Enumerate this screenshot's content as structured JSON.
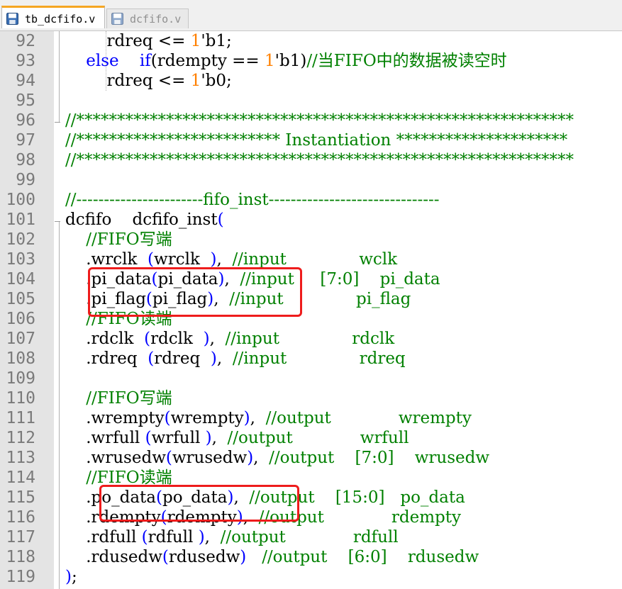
{
  "tabs": [
    {
      "label": "tb_dcfifo.v",
      "active": true,
      "icon": "save-disk-icon"
    },
    {
      "label": "dcfifo.v",
      "active": false,
      "icon": "save-disk-icon"
    }
  ],
  "colors": {
    "keyword": "#0000ff",
    "comment": "#008000",
    "number": "#ff8000",
    "highlight_box": "#ee1c1c",
    "active_tab_accent": "#f5a623"
  },
  "lines": [
    {
      "n": "92",
      "segs": [
        {
          "t": "        rdreq <= ",
          "c": ""
        },
        {
          "t": "1",
          "c": "num"
        },
        {
          "t": "'b1;",
          "c": ""
        }
      ]
    },
    {
      "n": "93",
      "segs": [
        {
          "t": "    ",
          "c": ""
        },
        {
          "t": "else",
          "c": "kw"
        },
        {
          "t": "    ",
          "c": ""
        },
        {
          "t": "if",
          "c": "kw"
        },
        {
          "t": "(rdempty == ",
          "c": ""
        },
        {
          "t": "1",
          "c": "num"
        },
        {
          "t": "'b1)",
          "c": ""
        },
        {
          "t": "//当FIFO中的数据被读空时",
          "c": "cm"
        }
      ]
    },
    {
      "n": "94",
      "segs": [
        {
          "t": "        rdreq <= ",
          "c": ""
        },
        {
          "t": "1",
          "c": "num"
        },
        {
          "t": "'b0;",
          "c": ""
        }
      ]
    },
    {
      "n": "95",
      "segs": []
    },
    {
      "n": "96",
      "segs": [
        {
          "t": "//*************************************************************",
          "c": "cm"
        }
      ]
    },
    {
      "n": "97",
      "segs": [
        {
          "t": "//************************* Instantiation *********************",
          "c": "cm"
        }
      ]
    },
    {
      "n": "98",
      "segs": [
        {
          "t": "//*************************************************************",
          "c": "cm"
        }
      ]
    },
    {
      "n": "99",
      "segs": []
    },
    {
      "n": "100",
      "segs": [
        {
          "t": "//-----------------------fifo_inst-------------------------------",
          "c": "cm"
        }
      ]
    },
    {
      "n": "101",
      "segs": [
        {
          "t": "dcfifo    dcfifo_inst",
          "c": ""
        },
        {
          "t": "(",
          "c": "br"
        }
      ]
    },
    {
      "n": "102",
      "segs": [
        {
          "t": "    ",
          "c": ""
        },
        {
          "t": "//FIFO写端",
          "c": "cm"
        }
      ]
    },
    {
      "n": "103",
      "segs": [
        {
          "t": "    .wrclk  ",
          "c": ""
        },
        {
          "t": "(",
          "c": "br"
        },
        {
          "t": "wrclk  ",
          "c": ""
        },
        {
          "t": ")",
          "c": "br"
        },
        {
          "t": ",  ",
          "c": ""
        },
        {
          "t": "//input              wclk",
          "c": "cm"
        }
      ]
    },
    {
      "n": "104",
      "segs": [
        {
          "t": "    .pi_data",
          "c": ""
        },
        {
          "t": "(",
          "c": "br"
        },
        {
          "t": "pi_data",
          "c": ""
        },
        {
          "t": ")",
          "c": "br"
        },
        {
          "t": ",  ",
          "c": ""
        },
        {
          "t": "//input     [7:0]    pi_data",
          "c": "cm"
        }
      ]
    },
    {
      "n": "105",
      "segs": [
        {
          "t": "    .pi_flag",
          "c": ""
        },
        {
          "t": "(",
          "c": "br"
        },
        {
          "t": "pi_flag",
          "c": ""
        },
        {
          "t": ")",
          "c": "br"
        },
        {
          "t": ",  ",
          "c": ""
        },
        {
          "t": "//input              pi_flag",
          "c": "cm"
        }
      ]
    },
    {
      "n": "106",
      "segs": [
        {
          "t": "    ",
          "c": ""
        },
        {
          "t": "//FIFO读端",
          "c": "cm"
        }
      ]
    },
    {
      "n": "107",
      "segs": [
        {
          "t": "    .rdclk  ",
          "c": ""
        },
        {
          "t": "(",
          "c": "br"
        },
        {
          "t": "rdclk  ",
          "c": ""
        },
        {
          "t": ")",
          "c": "br"
        },
        {
          "t": ",  ",
          "c": ""
        },
        {
          "t": "//input              rdclk",
          "c": "cm"
        }
      ]
    },
    {
      "n": "108",
      "segs": [
        {
          "t": "    .rdreq  ",
          "c": ""
        },
        {
          "t": "(",
          "c": "br"
        },
        {
          "t": "rdreq  ",
          "c": ""
        },
        {
          "t": ")",
          "c": "br"
        },
        {
          "t": ",  ",
          "c": ""
        },
        {
          "t": "//input              rdreq",
          "c": "cm"
        }
      ]
    },
    {
      "n": "109",
      "segs": []
    },
    {
      "n": "110",
      "segs": [
        {
          "t": "    ",
          "c": ""
        },
        {
          "t": "//FIFO写端",
          "c": "cm"
        }
      ]
    },
    {
      "n": "111",
      "segs": [
        {
          "t": "    .wrempty",
          "c": ""
        },
        {
          "t": "(",
          "c": "br"
        },
        {
          "t": "wrempty",
          "c": ""
        },
        {
          "t": ")",
          "c": "br"
        },
        {
          "t": ",  ",
          "c": ""
        },
        {
          "t": "//output             wrempty",
          "c": "cm"
        }
      ]
    },
    {
      "n": "112",
      "segs": [
        {
          "t": "    .wrfull ",
          "c": ""
        },
        {
          "t": "(",
          "c": "br"
        },
        {
          "t": "wrfull ",
          "c": ""
        },
        {
          "t": ")",
          "c": "br"
        },
        {
          "t": ",  ",
          "c": ""
        },
        {
          "t": "//output             wrfull",
          "c": "cm"
        }
      ]
    },
    {
      "n": "113",
      "segs": [
        {
          "t": "    .wrusedw",
          "c": ""
        },
        {
          "t": "(",
          "c": "br"
        },
        {
          "t": "wrusedw",
          "c": ""
        },
        {
          "t": ")",
          "c": "br"
        },
        {
          "t": ",  ",
          "c": ""
        },
        {
          "t": "//output    [7:0]    wrusedw",
          "c": "cm"
        }
      ]
    },
    {
      "n": "114",
      "segs": [
        {
          "t": "    ",
          "c": ""
        },
        {
          "t": "//FIFO读端",
          "c": "cm"
        }
      ]
    },
    {
      "n": "115",
      "segs": [
        {
          "t": "    .po_data",
          "c": ""
        },
        {
          "t": "(",
          "c": "br"
        },
        {
          "t": "po_data",
          "c": ""
        },
        {
          "t": ")",
          "c": "br"
        },
        {
          "t": ",  ",
          "c": ""
        },
        {
          "t": "//output    [15:0]   po_data",
          "c": "cm"
        }
      ]
    },
    {
      "n": "116",
      "segs": [
        {
          "t": "    .rdempty",
          "c": ""
        },
        {
          "t": "(",
          "c": "br"
        },
        {
          "t": "rdempty",
          "c": ""
        },
        {
          "t": ")",
          "c": "br"
        },
        {
          "t": ",  ",
          "c": ""
        },
        {
          "t": "//output             rdempty",
          "c": "cm"
        }
      ]
    },
    {
      "n": "117",
      "segs": [
        {
          "t": "    .rdfull ",
          "c": ""
        },
        {
          "t": "(",
          "c": "br"
        },
        {
          "t": "rdfull ",
          "c": ""
        },
        {
          "t": ")",
          "c": "br"
        },
        {
          "t": ",  ",
          "c": ""
        },
        {
          "t": "//output             rdfull",
          "c": "cm"
        }
      ]
    },
    {
      "n": "118",
      "segs": [
        {
          "t": "    .rdusedw",
          "c": ""
        },
        {
          "t": "(",
          "c": "br"
        },
        {
          "t": "rdusedw",
          "c": ""
        },
        {
          "t": ")",
          "c": "br"
        },
        {
          "t": "   ",
          "c": ""
        },
        {
          "t": "//output    [6:0]    rdusedw",
          "c": "cm"
        }
      ]
    },
    {
      "n": "119",
      "segs": [
        {
          "t": ")",
          "c": "br"
        },
        {
          "t": ";",
          "c": ""
        }
      ]
    }
  ]
}
